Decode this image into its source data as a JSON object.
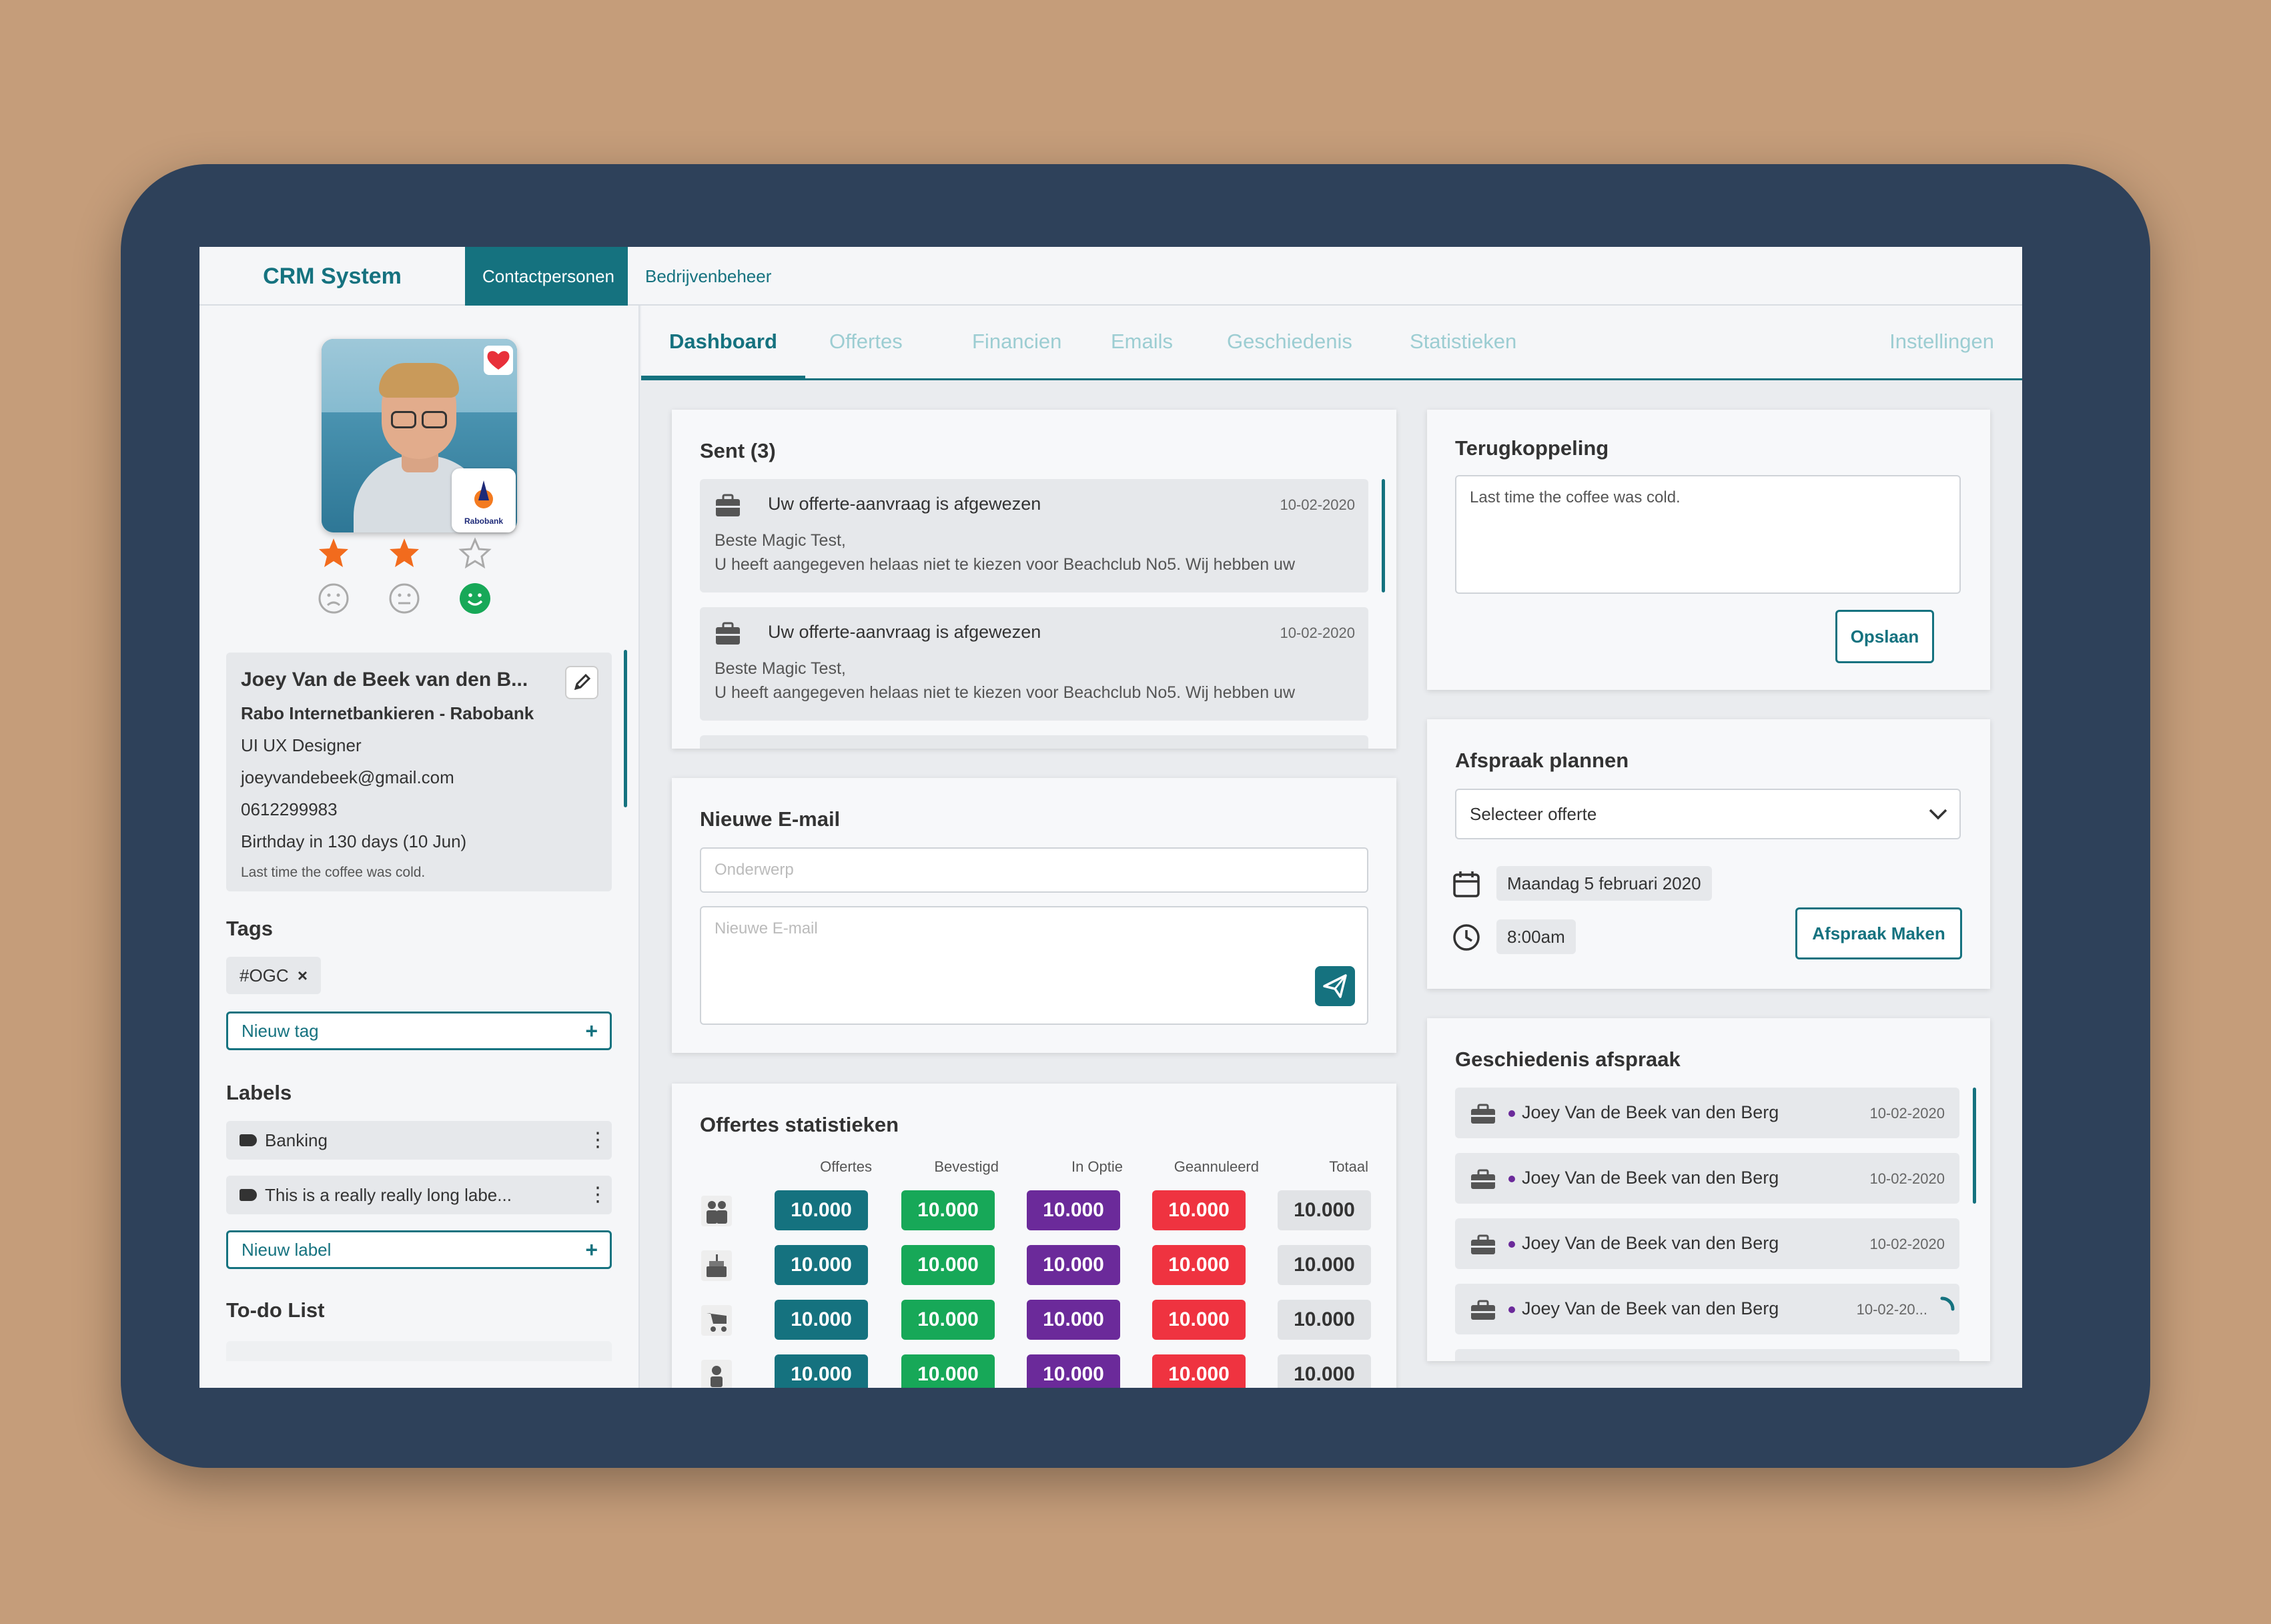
{
  "app": {
    "title": "CRM System"
  },
  "nav": {
    "tabs": [
      {
        "label": "Contactpersonen",
        "active": true
      },
      {
        "label": "Bedrijvenbeheer",
        "active": false
      }
    ]
  },
  "subnav": {
    "tabs": [
      "Dashboard",
      "Offertes",
      "Financien",
      "Emails",
      "Geschiedenis",
      "Statistieken"
    ],
    "active": "Dashboard",
    "settings": "Instellingen"
  },
  "profile": {
    "name": "Joey Van de Beek van den B...",
    "company": "Rabo Internetbankieren - Rabobank",
    "role": "UI UX Designer",
    "email": "joeyvandebeek@gmail.com",
    "phone": "0612299983",
    "birthday": "Birthday  in 130 days (10 Jun)",
    "note": "Last time the coffee was cold.",
    "rating": 2,
    "rating_max": 3,
    "mood": "happy",
    "favorite": true,
    "company_logo_text": "Rabobank"
  },
  "tags": {
    "title": "Tags",
    "items": [
      "#OGC"
    ],
    "new_placeholder": "Nieuw tag",
    "remove_glyph": "×"
  },
  "labels": {
    "title": "Labels",
    "items": [
      "Banking",
      "This is a really really long labe..."
    ],
    "new_placeholder": "Nieuw label"
  },
  "todo": {
    "title": "To-do List"
  },
  "sent": {
    "title": "Sent (3)",
    "messages": [
      {
        "subject": "Uw offerte-aanvraag is afgewezen",
        "date": "10-02-2020",
        "line1": "Beste Magic Test,",
        "line2": "U heeft aangegeven helaas niet te kiezen voor Beachclub No5. Wij hebben uw"
      },
      {
        "subject": "Uw offerte-aanvraag is afgewezen",
        "date": "10-02-2020",
        "line1": "Beste Magic Test,",
        "line2": "U heeft aangegeven helaas niet te kiezen voor Beachclub No5. Wij hebben uw"
      }
    ]
  },
  "new_email": {
    "title": "Nieuwe E-mail",
    "subject_placeholder": "Onderwerp",
    "body_placeholder": "Nieuwe E-mail"
  },
  "stats": {
    "title": "Offertes statistieken",
    "columns": [
      "Offertes",
      "Bevestigd",
      "In Optie",
      "Geannuleerd",
      "Totaal"
    ],
    "colors": {
      "offertes": "#15727f",
      "bevestigd": "#17a858",
      "in_optie": "#6b2a9a",
      "geannuleerd": "#ef3340"
    },
    "rows": [
      {
        "icon": "people-icon",
        "values": [
          "10.000",
          "10.000",
          "10.000",
          "10.000",
          "10.000"
        ]
      },
      {
        "icon": "cake-icon",
        "values": [
          "10.000",
          "10.000",
          "10.000",
          "10.000",
          "10.000"
        ]
      },
      {
        "icon": "stroller-icon",
        "values": [
          "10.000",
          "10.000",
          "10.000",
          "10.000",
          "10.000"
        ]
      },
      {
        "icon": "party-icon",
        "values": [
          "10.000",
          "10.000",
          "10.000",
          "10.000",
          "10.000"
        ]
      }
    ]
  },
  "feedback": {
    "title": "Terugkoppeling",
    "text": "Last time the coffee was cold.",
    "save_label": "Opslaan"
  },
  "appointment": {
    "title": "Afspraak plannen",
    "select_value": "Selecteer offerte",
    "date": "Maandag 5 februari 2020",
    "time": "8:00am",
    "button": "Afspraak Maken"
  },
  "history": {
    "title": "Geschiedenis afspraak",
    "items": [
      {
        "name": "Joey Van de Beek van den Berg",
        "date": "10-02-2020"
      },
      {
        "name": "Joey Van de Beek van den Berg",
        "date": "10-02-2020"
      },
      {
        "name": "Joey Van de Beek van den Berg",
        "date": "10-02-2020"
      },
      {
        "name": "Joey Van de Beek van den Berg",
        "date": "10-02-20..."
      }
    ]
  },
  "theme": {
    "accent": "#15727f",
    "frame": "#2e415a",
    "background": "#c59d7a",
    "star": "#f26b1d",
    "heart": "#e8303a",
    "mood_active": "#17a858"
  }
}
